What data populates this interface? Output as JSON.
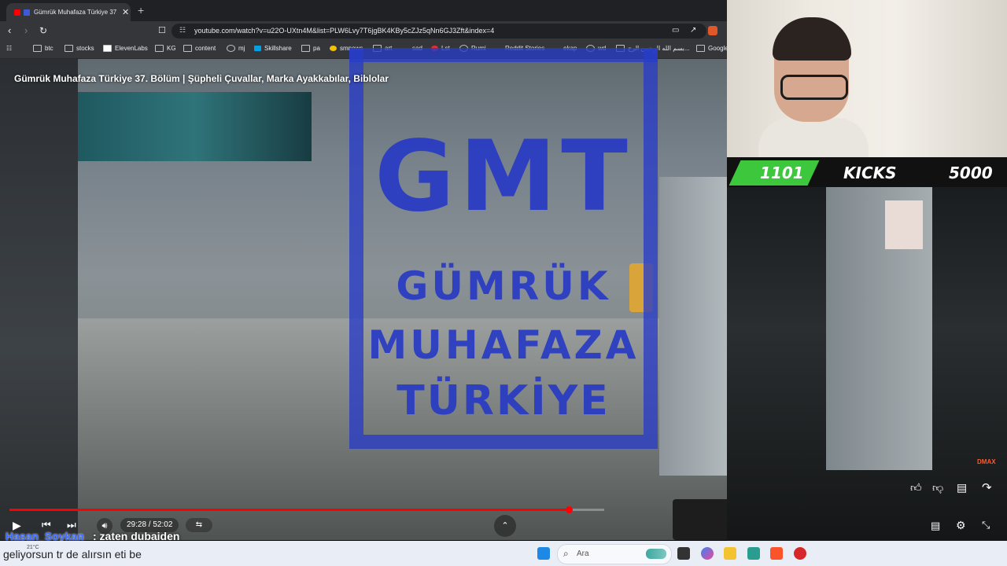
{
  "browser": {
    "tab_title": "Gümrük Muhafaza Türkiye 37",
    "tab_close": "✕",
    "new_tab": "+",
    "url": "youtube.com/watch?v=u22O-UXtn4M&list=PLW6Lvy7T6jgBK4KBy5cZJz5qNn6GJ3Zft&index=4",
    "bookmarks": [
      "btc",
      "stocks",
      "ElevenLabs",
      "KG",
      "content",
      "mj",
      "Skillshare",
      "pa",
      "smnews",
      "art",
      "sad",
      "Lst",
      "Rumi",
      "Reddit Stories",
      "ekap",
      "wd",
      "بسم الله الرحمن الرح...",
      "Google"
    ]
  },
  "video": {
    "title": "Gümrük Muhafaza Türkiye 37. Bölüm | Şüpheli Çuvallar, Marka Ayakkabılar, Biblolar",
    "logo_lines": [
      "GMT",
      "GÜMRÜK",
      "MUHAFAZA",
      "TÜRKİYE"
    ],
    "channel_badge": "DMAX",
    "time": "29:28 / 52:02",
    "progress": 0.94
  },
  "overlay": {
    "count_left": "1101",
    "label": "KICKS",
    "count_right": "5000"
  },
  "chat": {
    "user": "Hasan_Soykan",
    "message": ": zaten dubaiden"
  },
  "taskbar": {
    "temp": "21°C",
    "message": "geliyorsun tr de alırsın eti be",
    "search_label": "Ara"
  },
  "colors": {
    "accent_red": "#ff0000",
    "kick_green": "#3cc73c",
    "logo_blue": "#2638c4"
  }
}
